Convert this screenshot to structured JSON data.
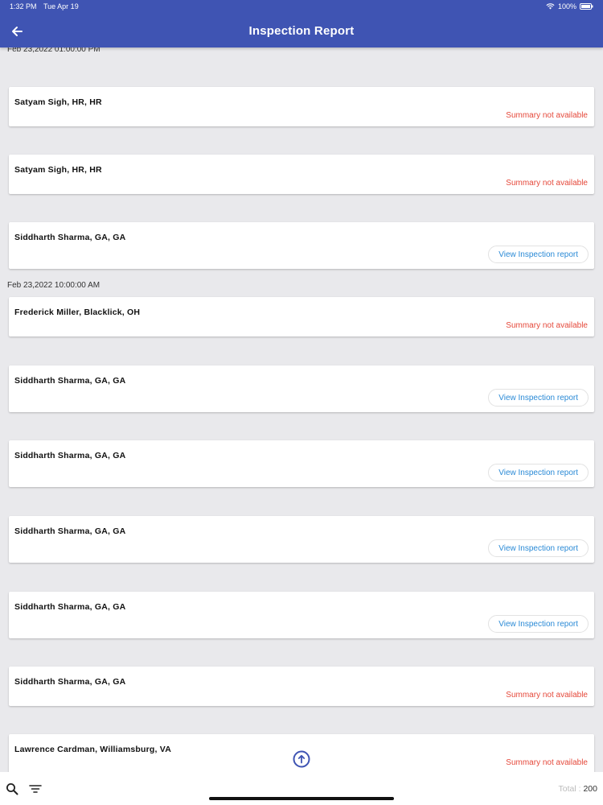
{
  "status_bar": {
    "time": "1:32 PM",
    "date": "Tue Apr 19",
    "battery": "100%"
  },
  "header": {
    "title": "Inspection Report",
    "back_icon": "arrow-left-icon"
  },
  "partial_date": "Feb 23,2022 01:00:00 PM",
  "date_groups": [
    "Feb 23,2022 10:00:00 AM"
  ],
  "records": [
    {
      "name": "Satyam Sigh, HR, HR",
      "summary": "Summary not available"
    },
    {
      "name": "Satyam Sigh, HR, HR",
      "summary": "Summary not available"
    },
    {
      "name": "Siddharth Sharma, GA, GA",
      "action": "View Inspection report"
    },
    {
      "name": "Frederick Miller, Blacklick, OH",
      "summary": "Summary not available"
    },
    {
      "name": "Siddharth Sharma, GA, GA",
      "action": "View Inspection report"
    },
    {
      "name": "Siddharth Sharma, GA, GA",
      "action": "View Inspection report"
    },
    {
      "name": "Siddharth Sharma, GA, GA",
      "action": "View Inspection report"
    },
    {
      "name": "Siddharth Sharma, GA, GA",
      "action": "View Inspection report"
    },
    {
      "name": "Siddharth Sharma, GA, GA",
      "summary": "Summary not available"
    },
    {
      "name": "Lawrence Cardman, Williamsburg, VA",
      "summary": "Summary not available"
    }
  ],
  "footer": {
    "total_label": "Total : ",
    "total_value": "200",
    "search_icon": "search-icon",
    "filter_icon": "filter-icon"
  },
  "colors": {
    "header": "#3f54b3",
    "summary": "#e5483a",
    "link": "#2a8ad6",
    "background": "#e9e9ec"
  }
}
